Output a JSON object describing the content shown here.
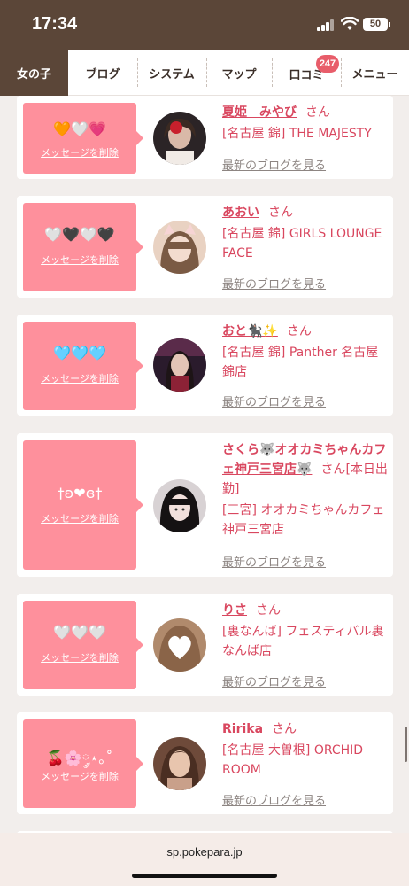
{
  "status_bar": {
    "time": "17:34",
    "battery": "50",
    "icons": [
      "signal-icon",
      "wifi-icon",
      "battery-icon"
    ]
  },
  "nav": {
    "tabs": [
      {
        "label": "女の子",
        "active": true
      },
      {
        "label": "ブログ",
        "active": false
      },
      {
        "label": "システム",
        "active": false
      },
      {
        "label": "マップ",
        "active": false
      },
      {
        "label": "口コミ",
        "active": false
      },
      {
        "label": "メニュー",
        "active": false
      }
    ],
    "review_badge": "247"
  },
  "cards": [
    {
      "message_emoji": "🧡🤍💗",
      "delete_label": "メッセージを削除",
      "name": "夏姫　みやび",
      "honorific": "さん",
      "area": "[名古屋 錦]",
      "shop": "THE MAJESTY",
      "blog_link": "最新のブログを見る"
    },
    {
      "message_emoji": "🤍🖤🤍🖤",
      "delete_label": "メッセージを削除",
      "name": "あおい",
      "honorific": "さん",
      "area": "[名古屋 錦]",
      "shop": "GIRLS LOUNGE FACE",
      "blog_link": "最新のブログを見る"
    },
    {
      "message_emoji": "🩵🩵🩵",
      "delete_label": "メッセージを削除",
      "name": "おと🐈‍⬛✨",
      "honorific": "さん",
      "area": "[名古屋 錦]",
      "shop": "Panther 名古屋錦店",
      "blog_link": "最新のブログを見る"
    },
    {
      "message_emoji": "†ʚ❤ɞ†",
      "delete_label": "メッセージを削除",
      "name": "さくら🐺オオカミちゃんカフェ神戸三宮店🐺",
      "honorific": "さん",
      "status": "[本日出勤]",
      "area": "[三宮]",
      "shop": "オオカミちゃんカフェ神戸三宮店",
      "blog_link": "最新のブログを見る"
    },
    {
      "message_emoji": "🤍🤍🤍",
      "delete_label": "メッセージを削除",
      "name": "りさ",
      "honorific": "さん",
      "area": "[裏なんば]",
      "shop": "フェスティバル裏なんば店",
      "blog_link": "最新のブログを見る"
    },
    {
      "message_emoji": "🍒🌸༘⋆｡˚",
      "delete_label": "メッセージを削除",
      "name": "Ririka",
      "honorific": "さん",
      "area": "[名古屋 大曽根]",
      "shop": "ORCHID ROOM",
      "blog_link": "最新のブログを見る"
    }
  ],
  "browser": {
    "url": "sp.pokepara.jp"
  },
  "colors": {
    "header_brown": "#5b4638",
    "message_pink": "#fe909c",
    "name_pink": "#d9475f",
    "link_gray": "#8d8582",
    "badge_red": "#e85d6a"
  }
}
